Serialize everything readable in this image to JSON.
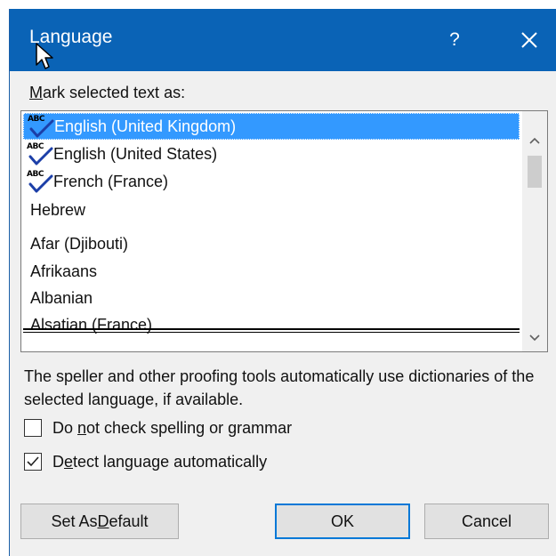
{
  "dialog": {
    "title": "Language",
    "help_label": "?",
    "close_icon": "close-icon"
  },
  "list": {
    "label_prefix": "",
    "label_mnemonic": "M",
    "label_rest": "ark selected text as:",
    "items": [
      {
        "label": "English (United Kingdom)",
        "spell_icon": true,
        "selected": true
      },
      {
        "label": "English (United States)",
        "spell_icon": true,
        "selected": false
      },
      {
        "label": "French (France)",
        "spell_icon": true,
        "selected": false
      },
      {
        "label": "Hebrew",
        "spell_icon": false,
        "selected": false
      },
      {
        "label": "Afar (Djibouti)",
        "spell_icon": false,
        "selected": false
      },
      {
        "label": "Afrikaans",
        "spell_icon": false,
        "selected": false
      },
      {
        "label": "Albanian",
        "spell_icon": false,
        "selected": false
      },
      {
        "label": "Alsatian (France)",
        "spell_icon": false,
        "selected": false
      }
    ],
    "spell_icon_text": "ABC",
    "scroll_up_icon": "chevron-up-icon",
    "scroll_down_icon": "chevron-down-icon"
  },
  "info": {
    "text": "The speller and other proofing tools automatically use dictionaries of the selected language, if available."
  },
  "options": {
    "no_check": {
      "prefix": "Do ",
      "mnemonic": "n",
      "rest": "ot check spelling or grammar",
      "checked": false
    },
    "detect": {
      "prefix": "D",
      "mnemonic": "e",
      "rest": "tect language automatically",
      "checked": true
    }
  },
  "buttons": {
    "set_default": {
      "prefix": "Set As ",
      "mnemonic": "D",
      "rest": "efault"
    },
    "ok": "OK",
    "cancel": "Cancel"
  },
  "colors": {
    "titlebar": "#0a63b6",
    "selection": "#3399ff",
    "default_button_border": "#0078d7"
  }
}
